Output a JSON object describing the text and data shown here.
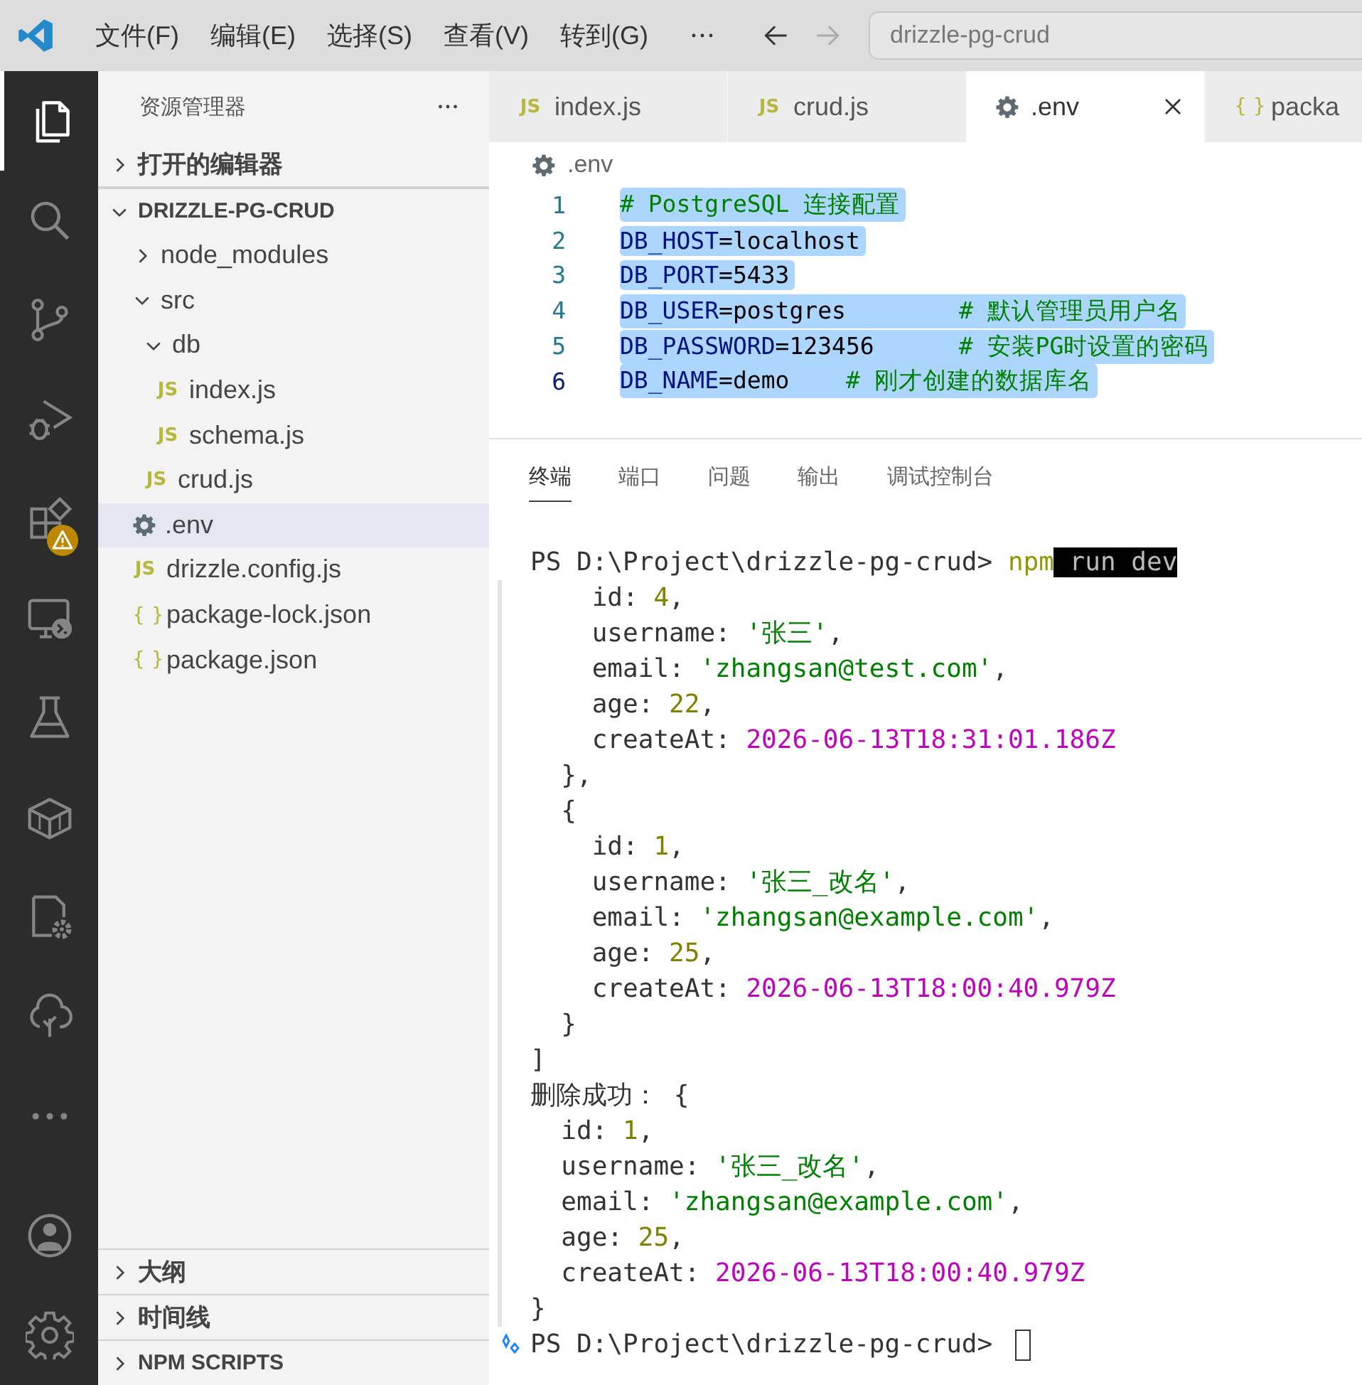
{
  "title_bar": {
    "menus": [
      "文件(F)",
      "编辑(E)",
      "选择(S)",
      "查看(V)",
      "转到(G)"
    ],
    "command_center": "drizzle-pg-crud"
  },
  "activity_bar": {
    "items": [
      {
        "kind": "files",
        "selected": true
      },
      {
        "kind": "search",
        "selected": false
      },
      {
        "kind": "source-control",
        "selected": false
      },
      {
        "kind": "run-debug",
        "selected": false
      },
      {
        "kind": "extensions",
        "selected": false,
        "warning_badge": true
      },
      {
        "kind": "remote",
        "selected": false
      },
      {
        "kind": "testing",
        "selected": false
      },
      {
        "kind": "box",
        "selected": false
      },
      {
        "kind": "gear-doc",
        "selected": false
      },
      {
        "kind": "tree",
        "selected": false
      },
      {
        "kind": "more",
        "selected": false
      }
    ],
    "bottom_items": [
      {
        "kind": "account",
        "selected": false
      },
      {
        "kind": "settings",
        "selected": false
      }
    ]
  },
  "sidebar": {
    "title": "资源管理器",
    "sections": [
      {
        "label": "打开的编辑器",
        "expanded": false
      },
      {
        "label": "DRIZZLE-PG-CRUD",
        "expanded": true,
        "tree": [
          {
            "label": "node_modules",
            "kind": "folder",
            "expanded": false,
            "selected": false
          },
          {
            "label": "src",
            "kind": "folder",
            "expanded": true,
            "selected": false,
            "children": [
              {
                "label": "db",
                "kind": "folder",
                "expanded": true,
                "selected": false,
                "children": [
                  {
                    "label": "index.js",
                    "kind": "file",
                    "icon": "JS",
                    "selected": false
                  },
                  {
                    "label": "schema.js",
                    "kind": "file",
                    "icon": "JS",
                    "selected": false
                  }
                ]
              },
              {
                "label": "crud.js",
                "kind": "file",
                "icon": "JS",
                "selected": false
              }
            ]
          },
          {
            "label": ".env",
            "kind": "settings-file",
            "selected": true
          },
          {
            "label": "drizzle.config.js",
            "kind": "file",
            "icon": "JS",
            "selected": false
          },
          {
            "label": "package-lock.json",
            "kind": "json-file",
            "icon": "{ }",
            "selected": false
          },
          {
            "label": "package.json",
            "kind": "json-file",
            "icon": "{ }",
            "selected": false
          }
        ]
      },
      {
        "label": "大纲",
        "expanded": false
      },
      {
        "label": "时间线",
        "expanded": false
      },
      {
        "label": "NPM SCRIPTS",
        "expanded": false
      }
    ]
  },
  "editor": {
    "tabs": [
      {
        "label": "index.js",
        "kind": "file",
        "icon": "JS",
        "selected": false
      },
      {
        "label": "crud.js",
        "kind": "file",
        "icon": "JS",
        "selected": false
      },
      {
        "label": ".env",
        "kind": "settings-file",
        "selected": true
      },
      {
        "label": "packa",
        "kind": "json-file",
        "icon": "{ }",
        "selected": false
      }
    ],
    "breadcrumb": {
      "label": ".env",
      "kind": "settings-file"
    },
    "lines": [
      {
        "number": "1",
        "current": false,
        "selected": true,
        "segments": [
          {
            "text": "# PostgreSQL 连接配置",
            "kind": "comment"
          }
        ]
      },
      {
        "number": "2",
        "current": false,
        "selected": true,
        "segments": [
          {
            "text": "DB_HOST",
            "kind": "key"
          },
          {
            "text": "=localhost",
            "kind": "plain"
          }
        ]
      },
      {
        "number": "3",
        "current": false,
        "selected": true,
        "segments": [
          {
            "text": "DB_PORT",
            "kind": "key"
          },
          {
            "text": "=5433",
            "kind": "plain"
          }
        ]
      },
      {
        "number": "4",
        "current": false,
        "selected": true,
        "segments": [
          {
            "text": "DB_USER",
            "kind": "key"
          },
          {
            "text": "=postgres        ",
            "kind": "plain"
          },
          {
            "text": "# 默认管理员用户名",
            "kind": "comment"
          }
        ]
      },
      {
        "number": "5",
        "current": false,
        "selected": true,
        "segments": [
          {
            "text": "DB_PASSWORD",
            "kind": "key"
          },
          {
            "text": "=123456      ",
            "kind": "plain"
          },
          {
            "text": "# 安装PG时设置的密码",
            "kind": "comment"
          }
        ]
      },
      {
        "number": "6",
        "current": true,
        "selected": true,
        "segments": [
          {
            "text": "DB_NAME",
            "kind": "key"
          },
          {
            "text": "=demo    ",
            "kind": "plain"
          },
          {
            "text": "# 刚才创建的数据库名",
            "kind": "comment"
          }
        ]
      }
    ]
  },
  "panel": {
    "tabs": [
      {
        "label": "终端",
        "selected": true
      },
      {
        "label": "端口",
        "selected": false
      },
      {
        "label": "问题",
        "selected": false
      },
      {
        "label": "输出",
        "selected": false
      },
      {
        "label": "调试控制台",
        "selected": false
      }
    ],
    "terminal": {
      "lines": [
        {
          "kind": "prompt",
          "marker": false,
          "cursor": false,
          "segments": [
            {
              "text": "PS D:\\Project\\drizzle-pg-crud> ",
              "kind": "plain"
            },
            {
              "text": "npm",
              "kind": "command"
            },
            {
              "text": " run dev",
              "kind": "highlight"
            }
          ]
        },
        {
          "kind": "output",
          "segments": [
            {
              "text": "    id: ",
              "kind": "plain"
            },
            {
              "text": "4",
              "kind": "number"
            },
            {
              "text": ",",
              "kind": "plain"
            }
          ]
        },
        {
          "kind": "output",
          "segments": [
            {
              "text": "    username: ",
              "kind": "plain"
            },
            {
              "text": "'张三'",
              "kind": "string"
            },
            {
              "text": ",",
              "kind": "plain"
            }
          ]
        },
        {
          "kind": "output",
          "segments": [
            {
              "text": "    email: ",
              "kind": "plain"
            },
            {
              "text": "'zhangsan@test.com'",
              "kind": "string"
            },
            {
              "text": ",",
              "kind": "plain"
            }
          ]
        },
        {
          "kind": "output",
          "segments": [
            {
              "text": "    age: ",
              "kind": "plain"
            },
            {
              "text": "22",
              "kind": "number"
            },
            {
              "text": ",",
              "kind": "plain"
            }
          ]
        },
        {
          "kind": "output",
          "segments": [
            {
              "text": "    createAt: ",
              "kind": "plain"
            },
            {
              "text": "2026-06-13T18:31:01.186Z",
              "kind": "date"
            }
          ]
        },
        {
          "kind": "output",
          "segments": [
            {
              "text": "  },",
              "kind": "plain"
            }
          ]
        },
        {
          "kind": "output",
          "segments": [
            {
              "text": "  {",
              "kind": "plain"
            }
          ]
        },
        {
          "kind": "output",
          "segments": [
            {
              "text": "    id: ",
              "kind": "plain"
            },
            {
              "text": "1",
              "kind": "number"
            },
            {
              "text": ",",
              "kind": "plain"
            }
          ]
        },
        {
          "kind": "output",
          "segments": [
            {
              "text": "    username: ",
              "kind": "plain"
            },
            {
              "text": "'张三_改名'",
              "kind": "string"
            },
            {
              "text": ",",
              "kind": "plain"
            }
          ]
        },
        {
          "kind": "output",
          "segments": [
            {
              "text": "    email: ",
              "kind": "plain"
            },
            {
              "text": "'zhangsan@example.com'",
              "kind": "string"
            },
            {
              "text": ",",
              "kind": "plain"
            }
          ]
        },
        {
          "kind": "output",
          "segments": [
            {
              "text": "    age: ",
              "kind": "plain"
            },
            {
              "text": "25",
              "kind": "number"
            },
            {
              "text": ",",
              "kind": "plain"
            }
          ]
        },
        {
          "kind": "output",
          "segments": [
            {
              "text": "    createAt: ",
              "kind": "plain"
            },
            {
              "text": "2026-06-13T18:00:40.979Z",
              "kind": "date"
            }
          ]
        },
        {
          "kind": "output",
          "segments": [
            {
              "text": "  }",
              "kind": "plain"
            }
          ]
        },
        {
          "kind": "output",
          "segments": [
            {
              "text": "]",
              "kind": "plain"
            }
          ]
        },
        {
          "kind": "output",
          "segments": [
            {
              "text": "删除成功： {",
              "kind": "plain"
            }
          ]
        },
        {
          "kind": "output",
          "segments": [
            {
              "text": "  id: ",
              "kind": "plain"
            },
            {
              "text": "1",
              "kind": "number"
            },
            {
              "text": ",",
              "kind": "plain"
            }
          ]
        },
        {
          "kind": "output",
          "segments": [
            {
              "text": "  username: ",
              "kind": "plain"
            },
            {
              "text": "'张三_改名'",
              "kind": "string"
            },
            {
              "text": ",",
              "kind": "plain"
            }
          ]
        },
        {
          "kind": "output",
          "segments": [
            {
              "text": "  email: ",
              "kind": "plain"
            },
            {
              "text": "'zhangsan@example.com'",
              "kind": "string"
            },
            {
              "text": ",",
              "kind": "plain"
            }
          ]
        },
        {
          "kind": "output",
          "segments": [
            {
              "text": "  age: ",
              "kind": "plain"
            },
            {
              "text": "25",
              "kind": "number"
            },
            {
              "text": ",",
              "kind": "plain"
            }
          ]
        },
        {
          "kind": "output",
          "segments": [
            {
              "text": "  createAt: ",
              "kind": "plain"
            },
            {
              "text": "2026-06-13T18:00:40.979Z",
              "kind": "date"
            }
          ]
        },
        {
          "kind": "output",
          "segments": [
            {
              "text": "}",
              "kind": "plain"
            }
          ]
        },
        {
          "kind": "prompt",
          "marker": true,
          "cursor": true,
          "segments": [
            {
              "text": "PS D:\\Project\\drizzle-pg-crud> ",
              "kind": "plain"
            }
          ]
        }
      ]
    }
  }
}
